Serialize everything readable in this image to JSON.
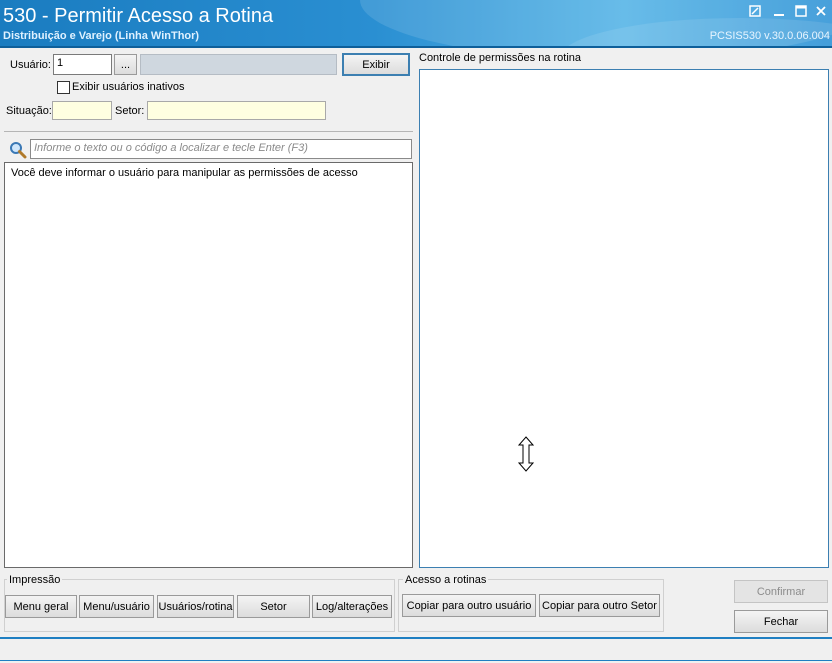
{
  "window": {
    "title": "530 - Permitir Acesso a Rotina",
    "subtitle": "Distribuição e Varejo (Linha WinThor)",
    "version": "PCSIS530  v.30.0.06.004",
    "controls": [
      "restore-icon",
      "minimize-icon",
      "maximize-icon",
      "close-icon"
    ]
  },
  "filters": {
    "usuario_label": "Usuário:",
    "usuario_value": "1",
    "lookup_label": "...",
    "usuario_name": "",
    "exibir_label": "Exibir",
    "inativos_label": "Exibir usuários inativos",
    "situacao_label": "Situação:",
    "situacao_value": "",
    "setor_label": "Setor:",
    "setor_value": ""
  },
  "search": {
    "icon": "search-icon",
    "placeholder": "Informe o texto ou o código a localizar e tecle Enter (F3)"
  },
  "menu_list": {
    "message": "Você deve informar o usuário para manipular as permissões de acesso"
  },
  "permissions": {
    "title": "Controle de permissões na rotina"
  },
  "impressao": {
    "title": "Impressão",
    "buttons": [
      "Menu geral",
      "Menu/usuário",
      "Usuários/rotina",
      "Setor",
      "Log/alterações"
    ]
  },
  "acesso": {
    "title": "Acesso a rotinas",
    "buttons": [
      "Copiar para outro usuário",
      "Copiar para outro Setor"
    ]
  },
  "actions": {
    "confirmar": "Confirmar",
    "fechar": "Fechar"
  }
}
